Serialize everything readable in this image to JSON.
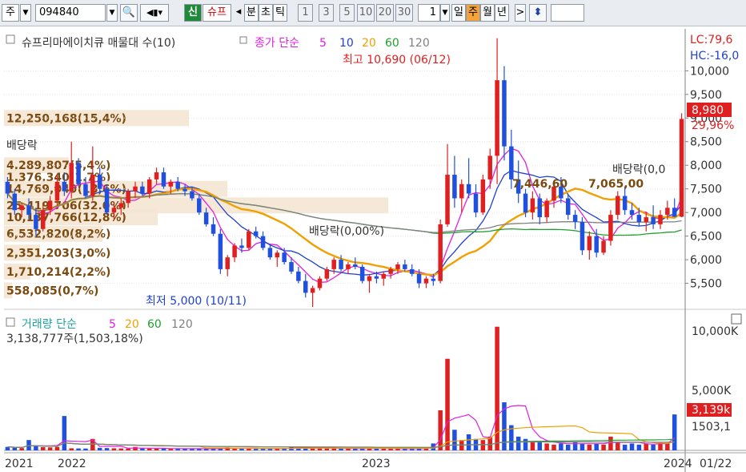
{
  "toolbar": {
    "period_label": "주",
    "code": "094840",
    "new_badge": "신",
    "stock_name_short": "슈프",
    "arrow_left": "◂",
    "intervals": [
      "분",
      "초",
      "틱"
    ],
    "minute_steps": [
      "1",
      "3",
      "5",
      "10",
      "20",
      "30"
    ],
    "count": "1",
    "periods": [
      "일",
      "주",
      "월",
      "년"
    ],
    "selected_period": "주",
    "arrow_right": ">",
    "updown": "⬍"
  },
  "chart_data": {
    "type": "candlestick",
    "title": "슈프리마에이치큐 매물대 수(10)",
    "legend_price": {
      "label": "종가 단순",
      "periods": [
        "5",
        "10",
        "20",
        "60",
        "120"
      ]
    },
    "legend_volume": {
      "label": "거래량 단순",
      "periods": [
        "5",
        "20",
        "60",
        "120"
      ]
    },
    "series_colors": {
      "ma5": "#e020e0",
      "ma10": "#2040d0",
      "ma20": "#f0a000",
      "ma60": "#20a030",
      "ma120": "#808080",
      "up": "#e02020",
      "down": "#2050e0"
    },
    "y_ticks": [
      "10,000",
      "9,500",
      "9,000",
      "8,500",
      "8,000",
      "7,500",
      "7,000",
      "6,500",
      "6,000",
      "5,500"
    ],
    "ylim": [
      4950,
      10820
    ],
    "scale_labels": {
      "lc": "LC:79,6",
      "hc": "HC:-16,0"
    },
    "current_price": "8,980",
    "current_change": "29,96%",
    "x_labels": [
      "2021",
      "2022",
      "2023",
      "2024",
      "01/22"
    ],
    "high_annotation": "최고 10,690 (06/12)",
    "low_annotation": "최저 5,000 (10/11)",
    "dividend_labels": [
      "배당락",
      "배당락(0,00%)",
      "배당락(0,0"
    ],
    "volume_profile": [
      {
        "price": 9000,
        "label": "12,250,168(15,4%)",
        "pct": 15.4
      },
      {
        "price": 8000,
        "label": "4,289,807(5,4%)",
        "pct": 5.4
      },
      {
        "price": 7750,
        "label": "1,376,340(1,7%)",
        "pct": 1.7
      },
      {
        "price": 7500,
        "label": "14,769,049(18,6%)",
        "pct": 18.6
      },
      {
        "price": 7150,
        "label": "25,419,706(32,0%)",
        "pct": 32.0
      },
      {
        "price": 6900,
        "label": "10,137,766(12,8%)",
        "pct": 12.8
      },
      {
        "price": 6550,
        "label": "6,532,820(8,2%)",
        "pct": 8.2
      },
      {
        "price": 6150,
        "label": "2,351,203(3,0%)",
        "pct": 3.0
      },
      {
        "price": 5750,
        "label": "1,710,214(2,2%)",
        "pct": 2.2
      },
      {
        "price": 5350,
        "label": "558,085(0,7%)",
        "pct": 0.7
      }
    ],
    "mid_labels": [
      "7,446,60",
      "7,065,00"
    ],
    "volume_axis": {
      "ticks": [
        "10,000K",
        "5,000K"
      ],
      "current": "3,139k",
      "ma_value": "1503,1"
    },
    "volume_summary": "3,138,777주(1,503,18%)",
    "candles": [
      [
        7650,
        7750,
        7300,
        7400
      ],
      [
        7400,
        7500,
        6950,
        7050
      ],
      [
        7050,
        7200,
        6900,
        7150
      ],
      [
        7150,
        7300,
        6850,
        6950
      ],
      [
        6950,
        7100,
        6500,
        6650
      ],
      [
        6650,
        7200,
        6600,
        7050
      ],
      [
        7050,
        7350,
        6950,
        7250
      ],
      [
        7250,
        7800,
        7150,
        7650
      ],
      [
        7650,
        7850,
        7350,
        7450
      ],
      [
        7450,
        8500,
        7300,
        8050
      ],
      [
        8050,
        8150,
        7550,
        7600
      ],
      [
        7600,
        7750,
        7300,
        7350
      ],
      [
        7350,
        8400,
        7250,
        7800
      ],
      [
        7800,
        7950,
        7400,
        7500
      ],
      [
        7500,
        7600,
        6950,
        7000
      ],
      [
        7000,
        7200,
        6850,
        7100
      ],
      [
        7100,
        7300,
        6950,
        7200
      ],
      [
        7200,
        7500,
        7100,
        7450
      ],
      [
        7450,
        7650,
        7300,
        7550
      ],
      [
        7550,
        7650,
        7350,
        7400
      ],
      [
        7400,
        7750,
        7300,
        7700
      ],
      [
        7700,
        7950,
        7600,
        7850
      ],
      [
        7850,
        7950,
        7500,
        7550
      ],
      [
        7550,
        7700,
        7400,
        7650
      ],
      [
        7650,
        7750,
        7450,
        7500
      ],
      [
        7500,
        7600,
        7350,
        7450
      ],
      [
        7450,
        7550,
        7250,
        7300
      ],
      [
        7300,
        7400,
        6950,
        7000
      ],
      [
        7000,
        7100,
        6700,
        6750
      ],
      [
        6750,
        6900,
        6500,
        6550
      ],
      [
        6550,
        6650,
        5700,
        5800
      ],
      [
        5800,
        6100,
        5650,
        6050
      ],
      [
        6050,
        6350,
        5950,
        6300
      ],
      [
        6300,
        6450,
        6150,
        6250
      ],
      [
        6250,
        6650,
        6200,
        6600
      ],
      [
        6600,
        6700,
        6450,
        6500
      ],
      [
        6500,
        6600,
        6200,
        6250
      ],
      [
        6250,
        6300,
        6000,
        6050
      ],
      [
        6050,
        6200,
        5850,
        6150
      ],
      [
        6150,
        6250,
        5900,
        5950
      ],
      [
        5950,
        6050,
        5700,
        5750
      ],
      [
        5750,
        5850,
        5500,
        5550
      ],
      [
        5550,
        5700,
        5200,
        5300
      ],
      [
        5300,
        5450,
        5000,
        5400
      ],
      [
        5400,
        5650,
        5350,
        5600
      ],
      [
        5600,
        5850,
        5550,
        5800
      ],
      [
        5800,
        6050,
        5700,
        6000
      ],
      [
        6000,
        6100,
        5750,
        5800
      ],
      [
        5800,
        5950,
        5700,
        5900
      ],
      [
        5900,
        6050,
        5800,
        5850
      ],
      [
        5850,
        5900,
        5500,
        5550
      ],
      [
        5550,
        5700,
        5300,
        5650
      ],
      [
        5650,
        5750,
        5500,
        5600
      ],
      [
        5600,
        5750,
        5450,
        5700
      ],
      [
        5700,
        5850,
        5600,
        5800
      ],
      [
        5800,
        5950,
        5700,
        5900
      ],
      [
        5900,
        6000,
        5750,
        5800
      ],
      [
        5800,
        5900,
        5650,
        5700
      ],
      [
        5700,
        5800,
        5400,
        5500
      ],
      [
        5500,
        5650,
        5400,
        5600
      ],
      [
        5600,
        5700,
        5450,
        5550
      ],
      [
        5550,
        6850,
        5500,
        6750
      ],
      [
        6750,
        8450,
        6700,
        7800
      ],
      [
        7800,
        8200,
        7100,
        7300
      ],
      [
        7300,
        7700,
        7000,
        7600
      ],
      [
        7600,
        8150,
        7300,
        7400
      ],
      [
        7400,
        7600,
        6900,
        7000
      ],
      [
        7000,
        7800,
        6950,
        7700
      ],
      [
        7700,
        8350,
        7500,
        8200
      ],
      [
        8200,
        10690,
        7600,
        9800
      ],
      [
        9800,
        10100,
        8100,
        8400
      ],
      [
        8400,
        8750,
        7500,
        7700
      ],
      [
        7700,
        8100,
        7200,
        7400
      ],
      [
        7400,
        7500,
        6900,
        7000
      ],
      [
        7000,
        7450,
        6850,
        7300
      ],
      [
        7300,
        7400,
        6750,
        6900
      ],
      [
        6900,
        7300,
        6800,
        7250
      ],
      [
        7250,
        7650,
        7100,
        7550
      ],
      [
        7550,
        7750,
        7200,
        7300
      ],
      [
        7300,
        7400,
        6850,
        6950
      ],
      [
        6950,
        7050,
        6650,
        6800
      ],
      [
        6800,
        6900,
        6100,
        6200
      ],
      [
        6200,
        6600,
        6000,
        6500
      ],
      [
        6500,
        6650,
        6050,
        6150
      ],
      [
        6150,
        6500,
        6100,
        6400
      ],
      [
        6400,
        7050,
        6300,
        6950
      ],
      [
        6950,
        7450,
        6850,
        7350
      ],
      [
        7350,
        7550,
        6950,
        7050
      ],
      [
        7050,
        7200,
        6850,
        6950
      ],
      [
        6950,
        7100,
        6700,
        6800
      ],
      [
        6800,
        7000,
        6600,
        6900
      ],
      [
        6900,
        7150,
        6650,
        6750
      ],
      [
        6750,
        7050,
        6650,
        6950
      ],
      [
        6950,
        7250,
        6850,
        7100
      ],
      [
        7100,
        7300,
        6900,
        6910
      ],
      [
        6910,
        9100,
        6900,
        8980
      ]
    ],
    "volumes": [
      300,
      250,
      200,
      900,
      350,
      280,
      260,
      300,
      3000,
      180,
      170,
      160,
      1000,
      220,
      200,
      180,
      170,
      160,
      300,
      170,
      160,
      150,
      140,
      160,
      150,
      140,
      140,
      130,
      150,
      160,
      200,
      260,
      170,
      160,
      180,
      150,
      140,
      160,
      150,
      200,
      300,
      250,
      320,
      200,
      180,
      170,
      160,
      150,
      140,
      170,
      160,
      180,
      150,
      140,
      160,
      150,
      140,
      150,
      160,
      170,
      600,
      3500,
      8000,
      1800,
      900,
      1400,
      1000,
      900,
      1200,
      10800,
      4200,
      2200,
      1200,
      1000,
      800,
      700,
      600,
      500,
      600,
      500,
      700,
      600,
      500,
      600,
      500,
      1200,
      700,
      500,
      600,
      500,
      600,
      500,
      700,
      600,
      3139
    ]
  }
}
